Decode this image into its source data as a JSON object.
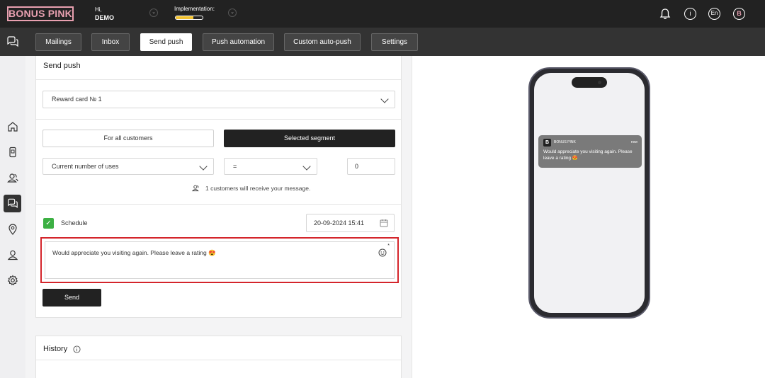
{
  "header": {
    "logo": "BONUS PINK",
    "greeting": "Hi,",
    "user_name": "DEMO",
    "implementation_label": "Implementation:",
    "implementation_progress": 0.65,
    "language": "En",
    "avatar_letter": "B",
    "info_glyph": "i"
  },
  "tabs": [
    {
      "label": "Mailings"
    },
    {
      "label": "Inbox"
    },
    {
      "label": "Send push"
    },
    {
      "label": "Push automation"
    },
    {
      "label": "Custom auto-push"
    },
    {
      "label": "Settings"
    }
  ],
  "active_tab": "Send push",
  "form": {
    "title": "Send push",
    "card_select": "Reward card № 1",
    "audience_all": "For all customers",
    "audience_segment": "Selected segment",
    "filter_field": "Current number of uses",
    "filter_operator": "=",
    "filter_value": "0",
    "recipients_hint": "1 customers will receive your message.",
    "schedule_label": "Schedule",
    "schedule_checked": true,
    "schedule_date": "20-09-2024 15:41",
    "message": "Would appreciate you visiting again. Please leave a rating 😍",
    "required_mark": "*",
    "send_label": "Send"
  },
  "history": {
    "title": "History"
  },
  "preview": {
    "app_name": "BONUS PINK",
    "time": "now",
    "icon_letter": "B",
    "body": "Would appreciate you visiting again. Please leave a rating 😍"
  },
  "colors": {
    "accent_pink": "#e8a0b0",
    "highlight_red": "#d4252b",
    "checkbox_green": "#3cb043",
    "progress_yellow": "#f2c230"
  },
  "icons": [
    "chat-icon",
    "home-icon",
    "phone-card-icon",
    "users-icon",
    "chat-rail-icon",
    "location-icon",
    "user-icon",
    "gear-icon",
    "bell-icon",
    "info-icon",
    "calendar-icon",
    "smiley-icon",
    "users-small-icon"
  ]
}
